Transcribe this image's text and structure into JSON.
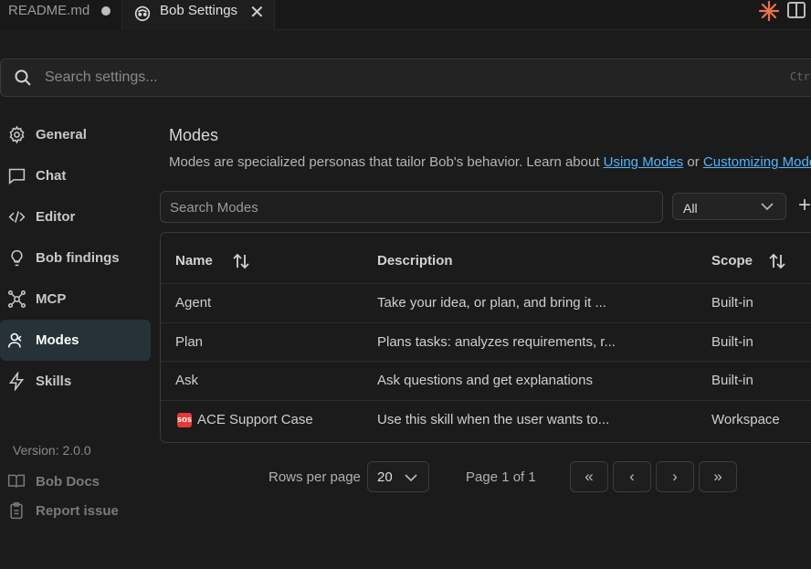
{
  "tabs": [
    {
      "label": "README.md",
      "modified": true
    },
    {
      "label": "Bob Settings",
      "close_glyph": "✕"
    }
  ],
  "search_settings": {
    "placeholder": "Search settings...",
    "shortcut": "Ctr"
  },
  "sidebar": {
    "items": [
      {
        "label": "General",
        "icon": "gear-icon"
      },
      {
        "label": "Chat",
        "icon": "chat-icon"
      },
      {
        "label": "Editor",
        "icon": "code-icon"
      },
      {
        "label": "Bob findings",
        "icon": "lightbulb-icon"
      },
      {
        "label": "MCP",
        "icon": "mcp-icon"
      },
      {
        "label": "Modes",
        "icon": "modes-icon",
        "active": true
      },
      {
        "label": "Skills",
        "icon": "bolt-icon"
      }
    ],
    "version": "Version: 2.0.0",
    "footer": [
      {
        "label": "Bob Docs",
        "icon": "book-icon"
      },
      {
        "label": "Report issue",
        "icon": "clipboard-icon"
      }
    ]
  },
  "main": {
    "title": "Modes",
    "description": "Modes are specialized personas that tailor Bob's behavior. Learn about ",
    "link1": "Using Modes",
    "or": " or ",
    "link2": "Customizing Modes",
    "search_placeholder": "Search Modes",
    "filter_value": "All",
    "add_glyph": "+",
    "table": {
      "headers": {
        "name": "Name",
        "description": "Description",
        "scope": "Scope"
      },
      "rows": [
        {
          "name": "Agent",
          "description": "Take your idea, or plan, and bring it ...",
          "scope": "Built-in"
        },
        {
          "name": "Plan",
          "description": "Plans tasks: analyzes requirements, r...",
          "scope": "Built-in"
        },
        {
          "name": "Ask",
          "description": "Ask questions and get explanations",
          "scope": "Built-in"
        },
        {
          "name": "ACE Support Case",
          "description": "Use this skill when the user wants to...",
          "scope": "Workspace",
          "badge": "SOS"
        }
      ]
    },
    "pagination": {
      "rows_label": "Rows per page",
      "rows_value": "20",
      "page_label": "Page 1 of 1",
      "first": "«",
      "prev": "‹",
      "next": "›",
      "last": "»"
    }
  },
  "colors": {
    "accent_link": "#4fb6ff",
    "active_nav": "#263238",
    "badge": "#e53935"
  }
}
